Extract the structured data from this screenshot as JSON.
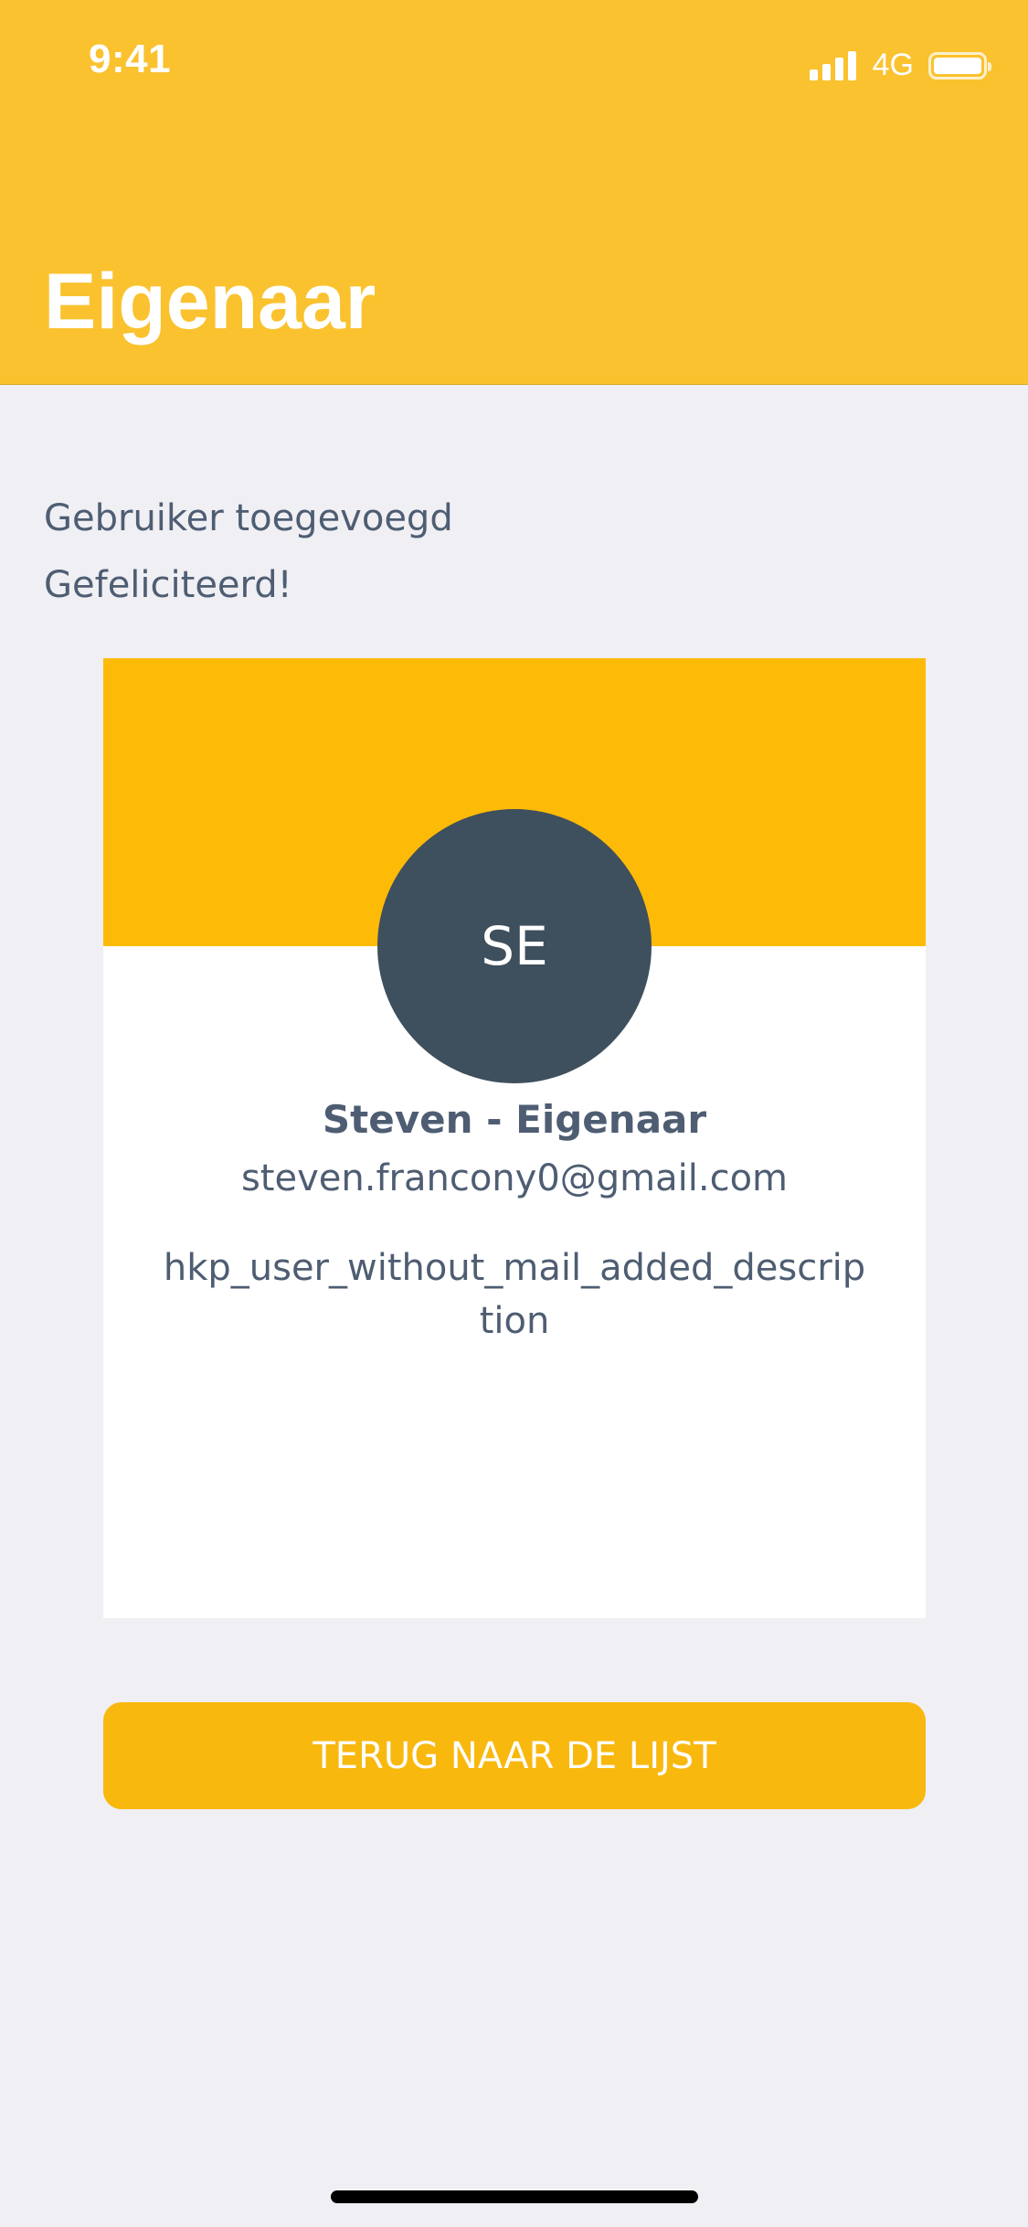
{
  "status_bar": {
    "time": "9:41",
    "network": "4G",
    "battery_level": 1.0,
    "signal_bars": 4
  },
  "header": {
    "title": "Eigenaar",
    "background": "#fac22f"
  },
  "messages": {
    "line1": "Gebruiker toegevoegd",
    "line2": "Gefeliciteerd!"
  },
  "user_card": {
    "banner_color": "#fdbb08",
    "avatar_initials": "SE",
    "avatar_color": "#3e4f5d",
    "name": "Steven - Eigenaar",
    "email": "steven.francony0@gmail.com",
    "description": "hkp_user_without_mail_added_description"
  },
  "actions": {
    "back_label": "TERUG NAAR DE LIJST",
    "back_color": "#f8b80e"
  }
}
